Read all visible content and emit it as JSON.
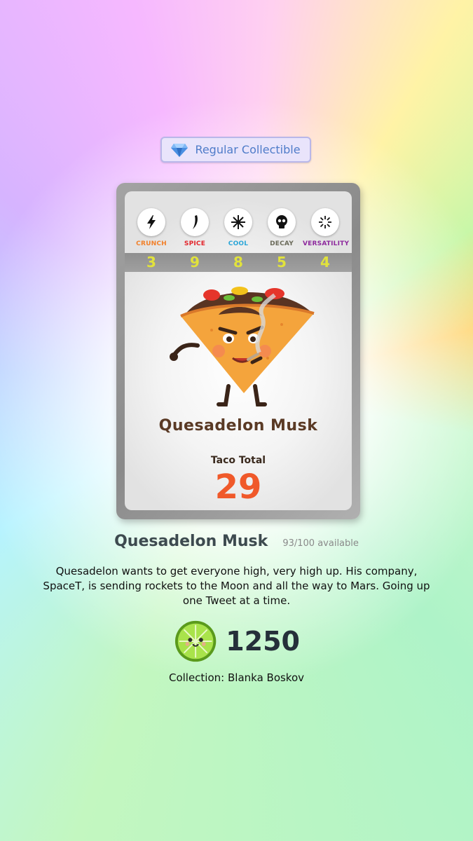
{
  "badge": {
    "label": "Regular Collectible",
    "icon": "gem-icon"
  },
  "card": {
    "stats": [
      {
        "label": "CRUNCH",
        "value": "3",
        "icon": "lightning-icon",
        "color": "#f2802a"
      },
      {
        "label": "SPICE",
        "value": "9",
        "icon": "chili-icon",
        "color": "#e3262c"
      },
      {
        "label": "COOL",
        "value": "8",
        "icon": "snowflake-icon",
        "color": "#2aa6d8"
      },
      {
        "label": "DECAY",
        "value": "5",
        "icon": "skull-icon",
        "color": "#6b6b5a"
      },
      {
        "label": "VERSATILITY",
        "value": "4",
        "icon": "burst-icon",
        "color": "#8e2a9e"
      }
    ],
    "name": "Quesadelon Musk",
    "taco_total_label": "Taco Total",
    "taco_total_value": "29"
  },
  "item": {
    "title": "Quesadelon Musk",
    "availability": "93/100 available",
    "description": "Quesadelon wants to get everyone high, very high up. His company, SpaceT, is sending rockets to the Moon and all the way to Mars. Going up one Tweet at a time.",
    "price": "1250",
    "price_icon": "lime-icon",
    "collection": "Collection: Blanka Boskov"
  },
  "colors": {
    "accent_orange": "#f0592a",
    "stat_value": "#e1e23c"
  }
}
